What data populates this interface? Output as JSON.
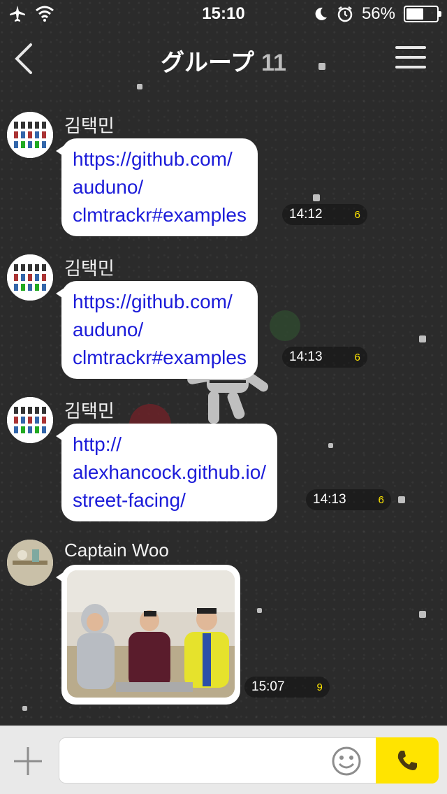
{
  "status_bar": {
    "time": "15:10",
    "battery_percent": "56%",
    "battery_level": 0.56,
    "icons": [
      "airplane-icon",
      "wifi-icon",
      "moon-icon",
      "alarm-icon",
      "battery-icon"
    ]
  },
  "nav": {
    "title": "グループ",
    "member_count": "11",
    "back_icon": "chevron-left-icon",
    "menu_icon": "hamburger-menu-icon"
  },
  "messages": [
    {
      "sender": "김택민",
      "lines": [
        "https://github.com/",
        "auduno/",
        "clmtrackr#examples"
      ],
      "time": "14:12",
      "unread": "6"
    },
    {
      "sender": "김택민",
      "lines": [
        "https://github.com/",
        "auduno/",
        "clmtrackr#examples"
      ],
      "time": "14:13",
      "unread": "6"
    },
    {
      "sender": "김택민",
      "lines": [
        "http://",
        "alexhancock.github.io/",
        "street-facing/"
      ],
      "time": "14:13",
      "unread": "6"
    },
    {
      "sender": "Captain Woo",
      "type": "photo",
      "time": "15:07",
      "unread": "9"
    }
  ],
  "input_bar": {
    "placeholder": "",
    "plus_icon": "plus-icon",
    "emoji_icon": "smiley-icon",
    "call_icon": "phone-icon"
  },
  "colors": {
    "background": "#2b2b2b",
    "link": "#1c1cd9",
    "unread": "#ffe600",
    "call_button": "#ffe400"
  }
}
